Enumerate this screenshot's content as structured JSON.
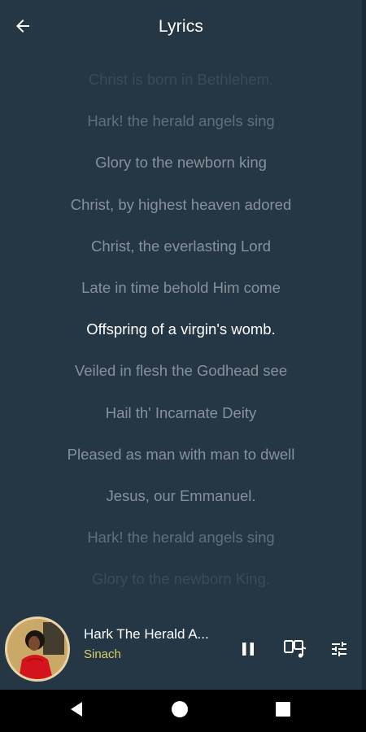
{
  "header": {
    "title": "Lyrics",
    "back_icon": "arrow-left-icon"
  },
  "lyrics": [
    "Christ is born in Bethlehem.",
    "Hark! the herald angels sing",
    "Glory to the newborn king",
    "Christ, by highest heaven adored",
    "Christ, the everlasting Lord",
    "Late in time behold Him come",
    "Offspring of a virgin's womb.",
    "Veiled in flesh the Godhead see",
    "Hail th' Incarnate Deity",
    "Pleased as man with man to dwell",
    "Jesus, our Emmanuel.",
    "Hark! the herald angels sing",
    "Glory to the newborn King."
  ],
  "player": {
    "song_title": "Hark The Herald A...",
    "artist": "Sinach",
    "icons": [
      "pause-icon",
      "music-library-icon",
      "equalizer-icon"
    ]
  },
  "navbar": {
    "icons": [
      "back-triangle-icon",
      "home-circle-icon",
      "recents-square-icon"
    ]
  },
  "colors": {
    "background": "#253645",
    "artist_accent": "#d9cf6a",
    "active_lyric": "#ffffff"
  }
}
